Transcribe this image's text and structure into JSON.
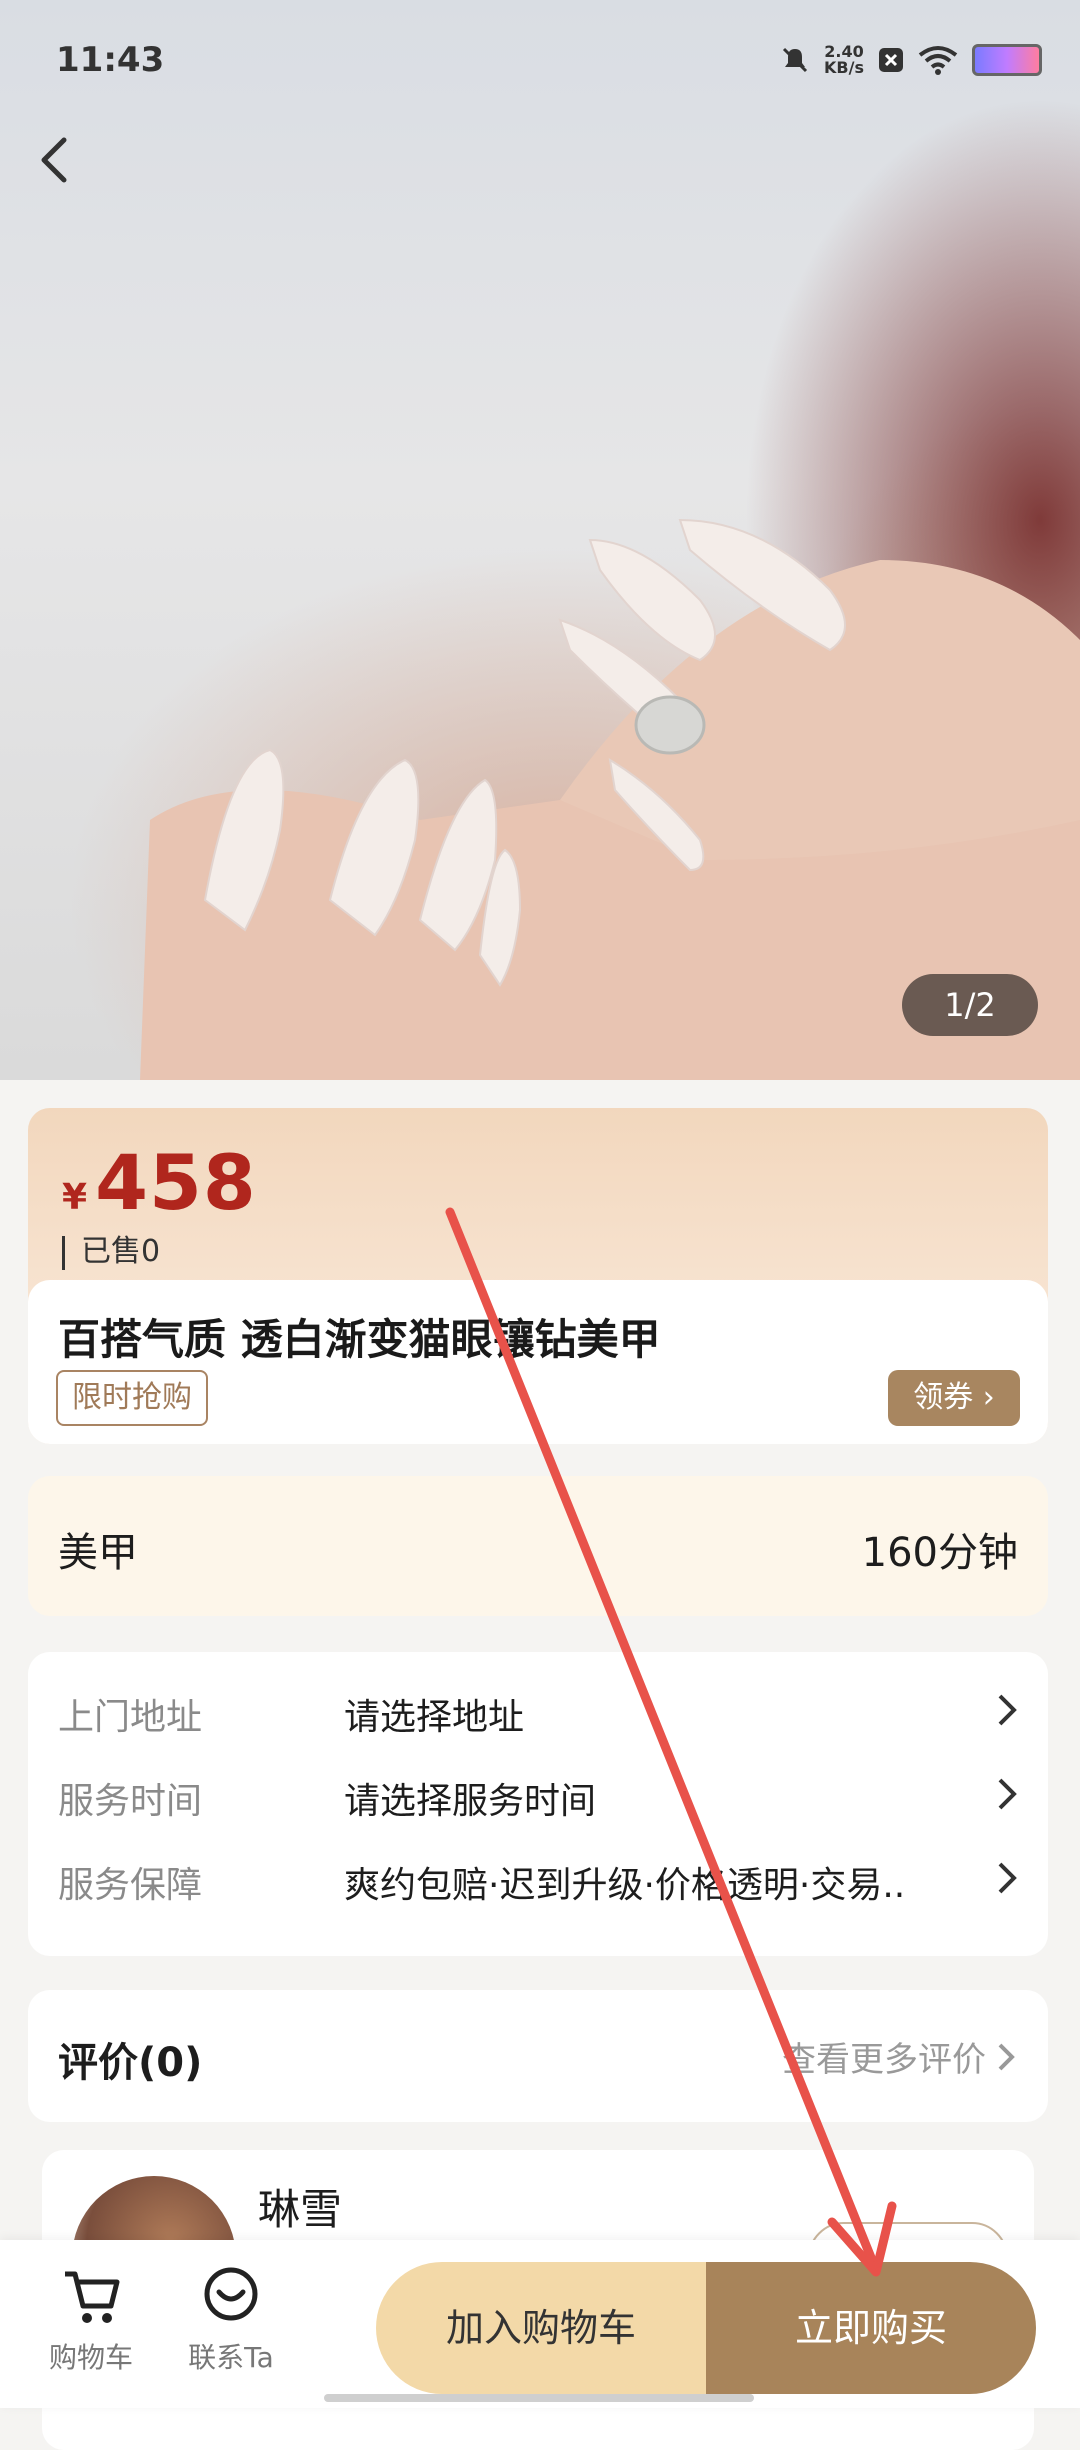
{
  "status_bar": {
    "time": "11:43",
    "net_speed_value": "2.40",
    "net_speed_unit": "KB/s"
  },
  "gallery": {
    "counter": "1/2"
  },
  "product": {
    "currency": "¥",
    "price": "458",
    "sold": "已售0",
    "title": "百搭气质 透白渐变猫眼镶钻美甲",
    "flash_tag": "限时抢购",
    "coupon_label": "领券"
  },
  "service": {
    "name": "美甲",
    "duration": "160分钟"
  },
  "info_rows": [
    {
      "label": "上门地址",
      "value": "请选择地址"
    },
    {
      "label": "服务时间",
      "value": "请选择服务时间"
    },
    {
      "label": "服务保障",
      "value": "爽约包赔·迟到升级·价格透明·交易.."
    }
  ],
  "reviews": {
    "title": "评价(0)",
    "more": "查看更多评价"
  },
  "artist": {
    "name": "琳雪"
  },
  "bottom_bar": {
    "cart_label": "购物车",
    "contact_label": "联系Ta",
    "add_cart_button": "加入购物车",
    "buy_now_button": "立即购买"
  },
  "colors": {
    "price": "#b0261d",
    "accent_brown": "#a8845a",
    "accent_light": "#f3d9a8",
    "annotation_arrow": "#e8524a"
  }
}
